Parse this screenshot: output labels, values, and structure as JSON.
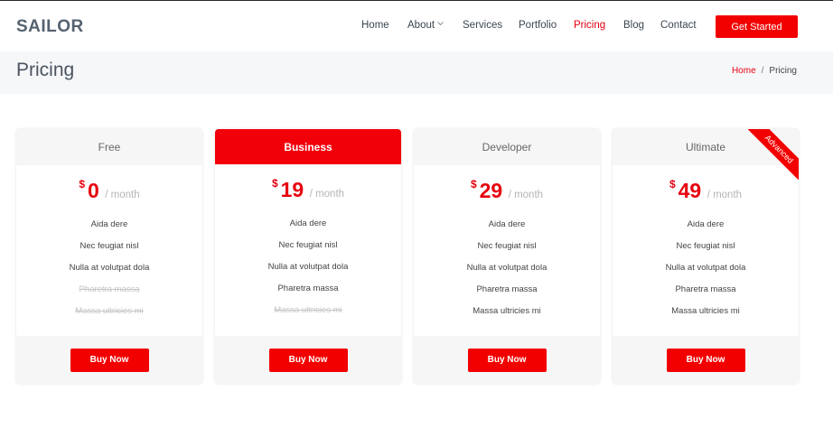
{
  "header": {
    "logo": "SAILOR",
    "nav": [
      {
        "label": "Home"
      },
      {
        "label": "About"
      },
      {
        "label": "Services"
      },
      {
        "label": "Portfolio"
      },
      {
        "label": "Pricing"
      },
      {
        "label": "Blog"
      },
      {
        "label": "Contact"
      }
    ],
    "cta_label": "Get Started",
    "accent_color": "#f20000"
  },
  "page": {
    "title": "Pricing",
    "breadcrumb": {
      "home": "Home",
      "separator": "/",
      "current": "Pricing"
    }
  },
  "plans": [
    {
      "name": "Free",
      "currency": "$",
      "amount": "0",
      "period": "/ month",
      "features": [
        "Aida dere",
        "Nec feugiat nisl",
        "Nulla at volutpat dola",
        "Pharetra massa",
        "Massa ultricies mi"
      ],
      "buy_label": "Buy Now"
    },
    {
      "name": "Business",
      "currency": "$",
      "amount": "19",
      "period": "/ month",
      "features": [
        "Aida dere",
        "Nec feugiat nisl",
        "Nulla at volutpat dola",
        "Pharetra massa",
        "Massa ultricies mi"
      ],
      "buy_label": "Buy Now"
    },
    {
      "name": "Developer",
      "currency": "$",
      "amount": "29",
      "period": "/ month",
      "features": [
        "Aida dere",
        "Nec feugiat nisl",
        "Nulla at volutpat dola",
        "Pharetra massa",
        "Massa ultricies mi"
      ],
      "buy_label": "Buy Now"
    },
    {
      "name": "Ultimate",
      "currency": "$",
      "amount": "49",
      "period": "/ month",
      "features": [
        "Aida dere",
        "Nec feugiat nisl",
        "Nulla at volutpat dola",
        "Pharetra massa",
        "Massa ultricies mi"
      ],
      "buy_label": "Buy Now",
      "ribbon": "Advanced"
    }
  ]
}
